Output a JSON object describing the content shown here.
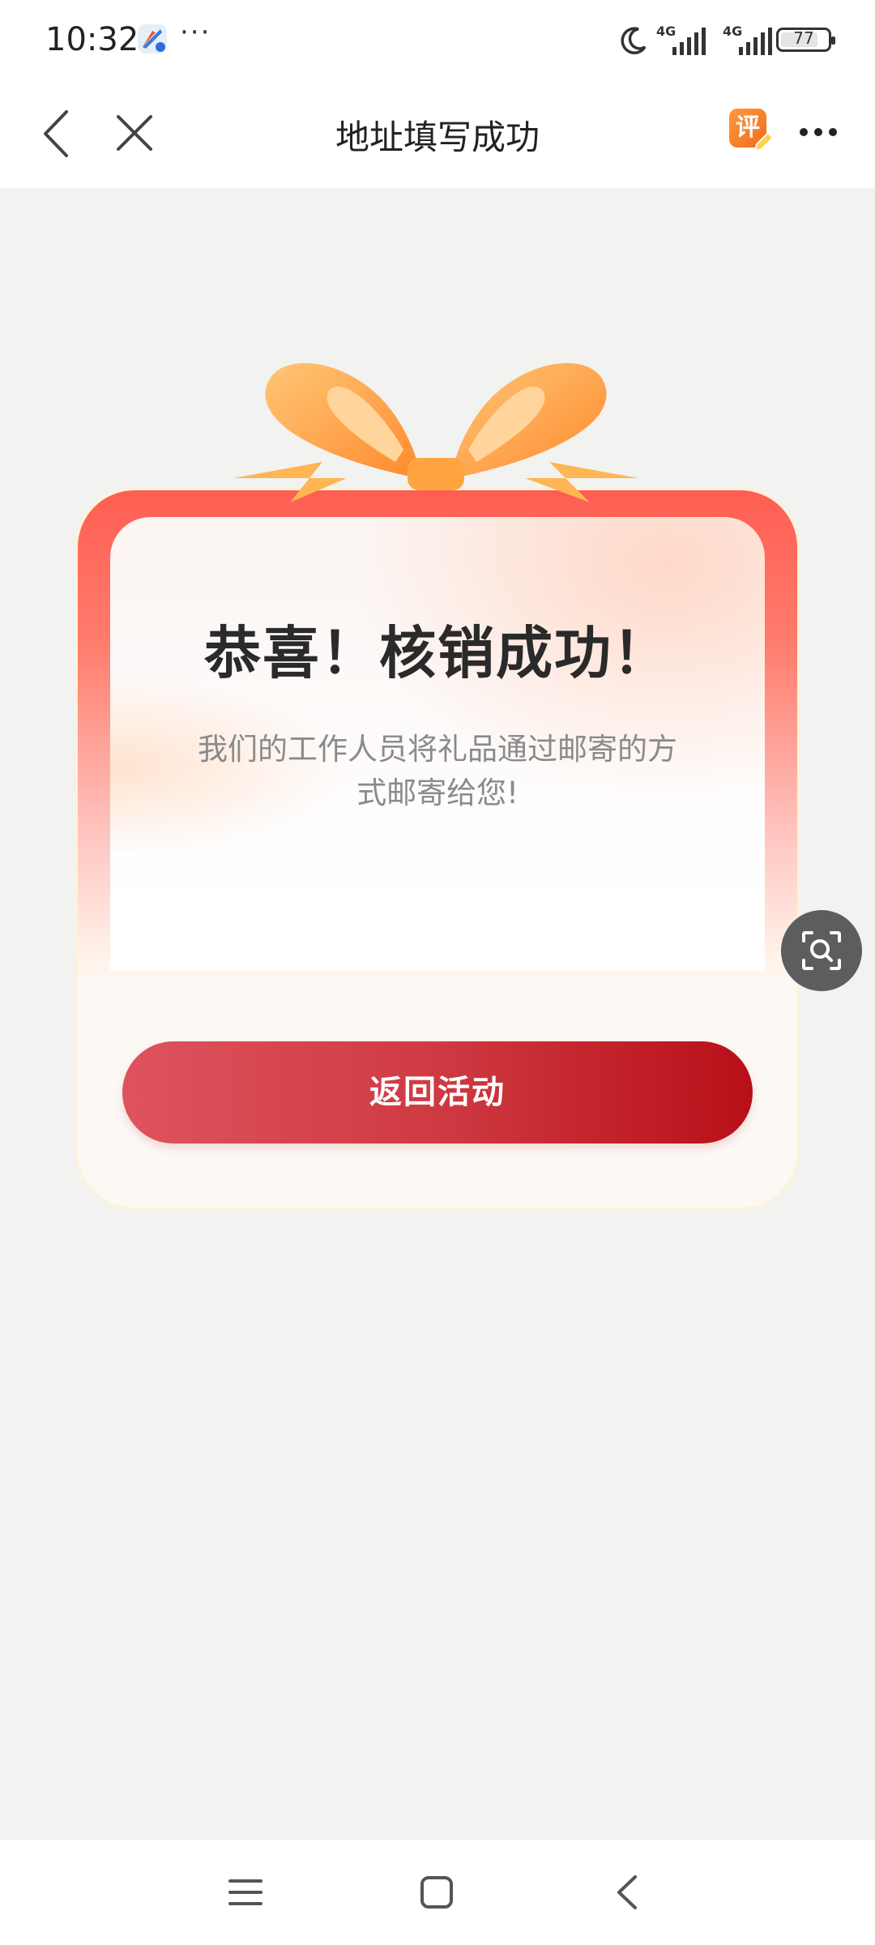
{
  "status_bar": {
    "time": "10:32",
    "more": "···",
    "signal1_label": "4G",
    "signal2_label": "4G",
    "battery": "77",
    "battery_level": 0.77
  },
  "nav": {
    "title": "地址填写成功",
    "rate_badge": "评"
  },
  "card": {
    "title": "恭喜！核销成功！",
    "description": "我们的工作人员将礼品通过邮寄的方式邮寄给您!",
    "button_label": "返回活动"
  },
  "colors": {
    "button_start": "#de535e",
    "button_end": "#b80f18",
    "card_top": "#ff5e52",
    "bow": "#ffae4f"
  },
  "icons": {
    "back": "back-icon",
    "close": "close-icon",
    "more": "more-icon",
    "lens": "lens-search-icon",
    "bottom_menu": "menu-icon",
    "bottom_home": "home-icon",
    "bottom_back": "nav-back-icon"
  }
}
